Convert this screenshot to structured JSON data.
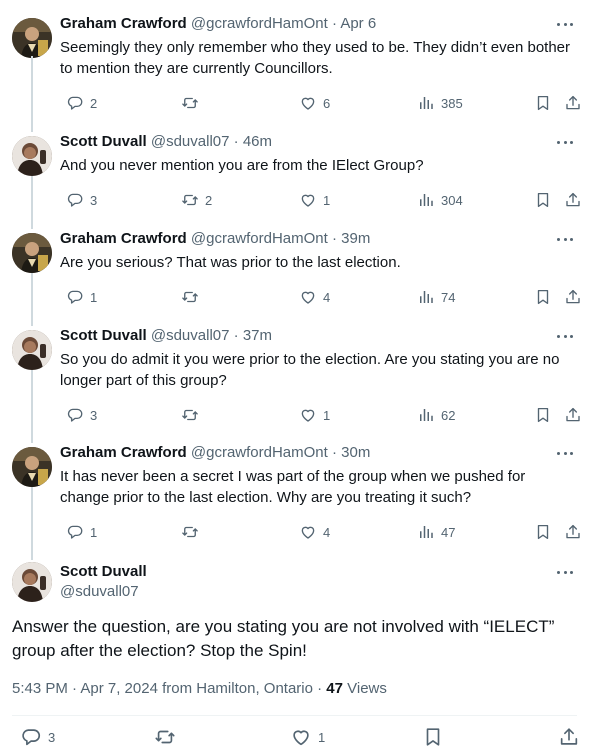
{
  "replies": [
    {
      "name": "Graham Crawford",
      "handle": "@gcrawfordHamOnt",
      "time": "Apr 6",
      "text": "Seemingly they only remember who they used to be. They didn’t even bother to mention they are currently Councillors.",
      "replies": "2",
      "reposts": "",
      "likes": "6",
      "views": "385",
      "avatar": "graham"
    },
    {
      "name": "Scott Duvall",
      "handle": "@sduvall07",
      "time": "46m",
      "text": "And you never mention you are from the IElect Group?",
      "replies": "3",
      "reposts": "2",
      "likes": "1",
      "views": "304",
      "avatar": "scott"
    },
    {
      "name": "Graham Crawford",
      "handle": "@gcrawfordHamOnt",
      "time": "39m",
      "text": "Are you serious? That was prior to the last election.",
      "replies": "1",
      "reposts": "",
      "likes": "4",
      "views": "74",
      "avatar": "graham"
    },
    {
      "name": "Scott Duvall",
      "handle": "@sduvall07",
      "time": "37m",
      "text": "So you do admit it you were prior to the election. Are you stating you are no longer part of this group?",
      "replies": "3",
      "reposts": "",
      "likes": "1",
      "views": "62",
      "avatar": "scott"
    },
    {
      "name": "Graham Crawford",
      "handle": "@gcrawfordHamOnt",
      "time": "30m",
      "text": "It has never been a secret I was part of the group when we pushed for change prior to the last election. Why are you treating it such?",
      "replies": "1",
      "reposts": "",
      "likes": "4",
      "views": "47",
      "avatar": "graham"
    }
  ],
  "main": {
    "name": "Scott Duvall",
    "handle": "@sduvall07",
    "text": "Answer the question, are you stating you are not involved with “IELECT” group after the election? Stop the Spin!",
    "meta_time": "5:43 PM · Apr 7, 2024 from Hamilton, Ontario · ",
    "views_count": "47",
    "views_label": " Views",
    "replies": "3",
    "reposts": "",
    "likes": "1"
  },
  "separator": "·",
  "icons": {
    "reply": "reply-icon",
    "repost": "repost-icon",
    "like": "heart-icon",
    "views": "views-chart-icon",
    "bookmark": "bookmark-icon",
    "share": "share-icon",
    "more": "more-dots-icon"
  },
  "colors": {
    "text": "#0f1419",
    "secondary": "#536471",
    "thread_line": "#cfd9de",
    "divider": "#eff3f4"
  }
}
